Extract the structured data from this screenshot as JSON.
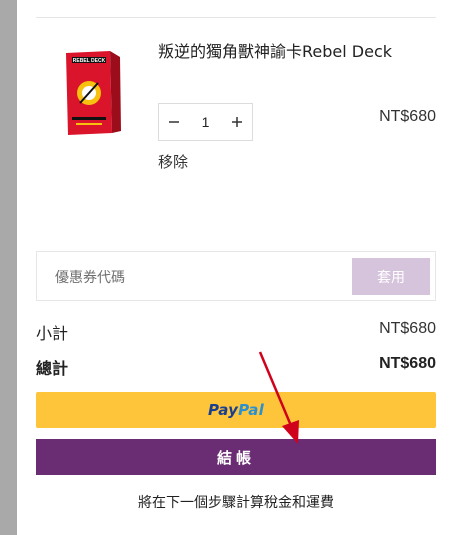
{
  "cart": {
    "item": {
      "title": "叛逆的獨角獸神諭卡Rebel Deck",
      "quantity": "1",
      "price": "NT$680",
      "remove_label": "移除",
      "decrease_icon": "minus-icon",
      "increase_icon": "plus-icon",
      "thumbnail_text": "REBEL DECK"
    },
    "coupon": {
      "placeholder": "優惠券代碼",
      "apply_label": "套用"
    },
    "summary": {
      "subtotal_label": "小計",
      "subtotal_value": "NT$680",
      "total_label": "總計",
      "total_value": "NT$680"
    },
    "paypal": {
      "label_pay": "Pay",
      "label_pal": "Pal"
    },
    "checkout": {
      "label": "結帳"
    },
    "note": "將在下一個步驟計算稅金和運費"
  },
  "colors": {
    "accent": "#6a2c73",
    "paypal_yellow": "#ffc53a",
    "apply_disabled": "#d6c4dc",
    "annotation_red": "#d0021b"
  }
}
